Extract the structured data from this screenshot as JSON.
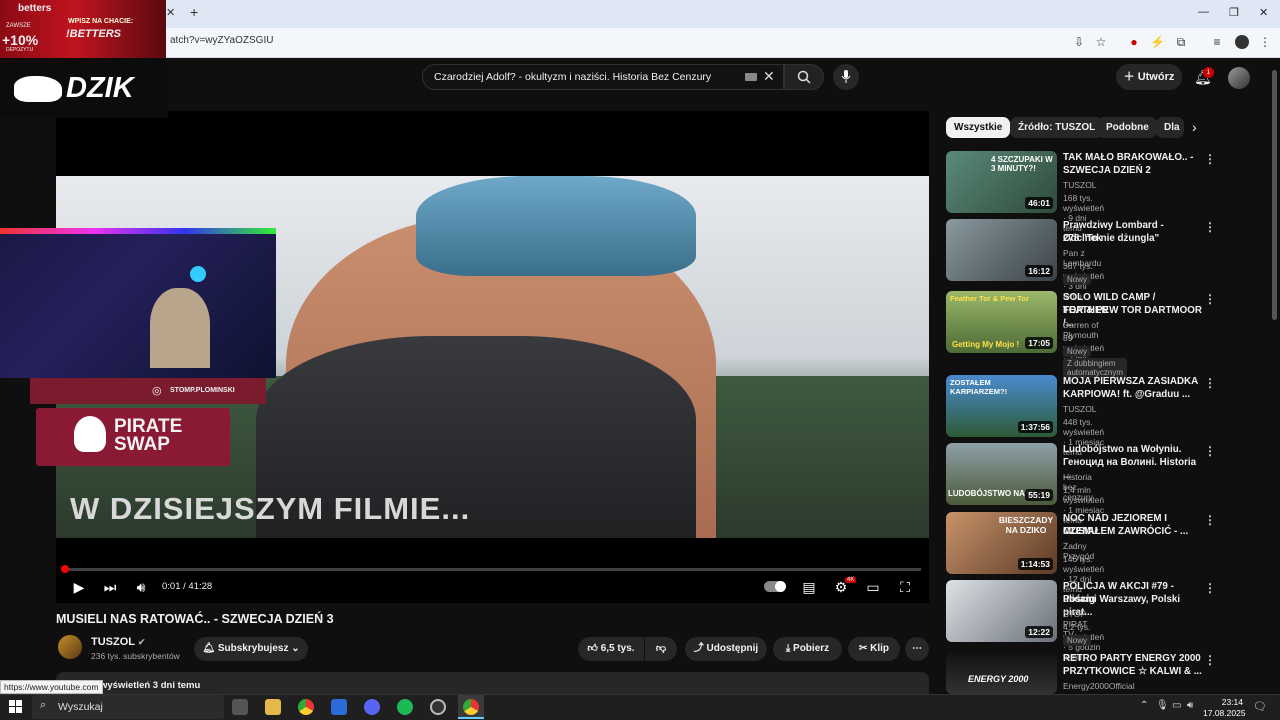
{
  "browser": {
    "url": "atch?v=wyZYaOZSGIU",
    "new_tab": "+",
    "minimize": "—",
    "restore": "❐",
    "close": "✕"
  },
  "overlays": {
    "betters_brand": "betters",
    "betters_promo_line1": "WPISZ NA CHACIE:",
    "betters_promo_line2": "!BETTERS",
    "betters_bonus": "+10%",
    "betters_bonus_label1": "ZAWSZE",
    "betters_bonus_label2": "DEPOZYTU",
    "dzik_logo": "DZIK",
    "cam_handle": "STOMP.PLOMINSKI",
    "pirate_line1": "PIRATE",
    "pirate_line2": "SWAP"
  },
  "search": {
    "query": "Czarodziej Adolf? - okultyzm i naziści. Historia Bez Cenzury"
  },
  "header": {
    "create_label": "Utwórz",
    "notifications_count": "1"
  },
  "player": {
    "caption": "W DZISIEJSZYM FILMIE...",
    "time": "0:01 / 41:28",
    "progress_fraction": 0.0004,
    "hd_badge": "4K"
  },
  "video": {
    "title": "MUSIELI NAS RATOWAĆ.. - SZWECJA DZIEŃ 3",
    "channel": "TUSZOL",
    "subscribers": "236 tys. subskrybentów",
    "subscribe_label": "Subskrybujesz",
    "likes": "6,5 tys.",
    "share_label": "Udostępnij",
    "download_label": "Pobierz",
    "clip_label": "Klip",
    "desc_views": "wyświetleń 3 dni temu"
  },
  "status_url": "https://www.youtube.com",
  "chips": [
    "Wszystkie",
    "Źródło: TUSZOL",
    "Podobne",
    "Dla"
  ],
  "sidebar": [
    {
      "title1": "TAK MAŁO BRAKOWAŁO.. -",
      "title2": "SZWECJA DZIEŃ 2",
      "channel": "TUSZOL",
      "meta": "168 tys. wyświetleń · 9 dni temu",
      "duration": "46:01",
      "thumb_text": "4 SZCZUPAKI W 3 MINUTY?!",
      "badge": ""
    },
    {
      "title1": "Prawdziwy Lombard - Odcinek",
      "title2": "278 \"To nie dżungla\"",
      "channel": "Pan z Lombardu",
      "meta": "367 tys. wyświetleń · 3 dni temu",
      "duration": "16:12",
      "thumb_text": "",
      "badge": "Nowy"
    },
    {
      "title1": "SOLO WILD CAMP / FEATHER",
      "title2": "TOR & PEW TOR DARTMOOR /...",
      "channel": "Darren of Plymouth",
      "meta": "89 wyświetleń · 2 dni temu",
      "duration": "17:05",
      "thumb_text": "Feather Tor & Pew Tor",
      "thumb_text2": "Getting My Mojo !",
      "badge": "Nowy",
      "badge2": "Z dubbingiem automatycznym"
    },
    {
      "title1": "MOJA PIERWSZA ZASIADKA",
      "title2": "KARPIOWA! ft. @Graduu ...",
      "channel": "TUSZOL",
      "meta": "448 tys. wyświetleń · 1 miesiąc temu",
      "duration": "1:37:56",
      "thumb_text": "ZOSTAŁEM KARPIARZEM?!",
      "badge": ""
    },
    {
      "title1": "Ludobójstwo na Wołyniu.",
      "title2": "Геноцид на Волині. Historia ...",
      "channel": "Historia bez cenzury",
      "meta": "1,4 mln wyświetleń · 1 miesiąc temu",
      "duration": "55:19",
      "thumb_text": "LUDOBÓJSTWO NA W",
      "badge": ""
    },
    {
      "title1": "NOC NAD JEZIOREM I CZEMU",
      "title2": "MUSIAŁEM ZAWRÓCIĆ - ...",
      "channel": "Żadny Przygód",
      "meta": "146 tys. wyświetleń · 12 dni temu",
      "duration": "1:14:53",
      "thumb_text": "BIESZCZADY NA DZIKO",
      "badge": ""
    },
    {
      "title1": "POLICJA W AKCJI #79 - Pościg",
      "title2": "ulicami Warszawy, Polski pirat...",
      "channel": "STOP PIRAT TV",
      "meta": "4,2 tys. wyświetleń · 5 godzin temu",
      "duration": "12:22",
      "thumb_text": "",
      "badge": "Nowy"
    },
    {
      "title1": "RETRO PARTY ENERGY 2000",
      "title2": "PRZYTKOWICE ☆ KALWI & ...",
      "channel": "Energy2000Official",
      "meta": "",
      "duration": "",
      "thumb_text": "ENERGY 2000",
      "badge": ""
    }
  ],
  "taskbar": {
    "search_label": "Wyszukaj",
    "time": "23:14",
    "date": "17.08.2025"
  },
  "colors": {
    "yt_red": "#ff0000",
    "bg": "#0f0f0f",
    "chip_active": "#f1f1f1"
  }
}
